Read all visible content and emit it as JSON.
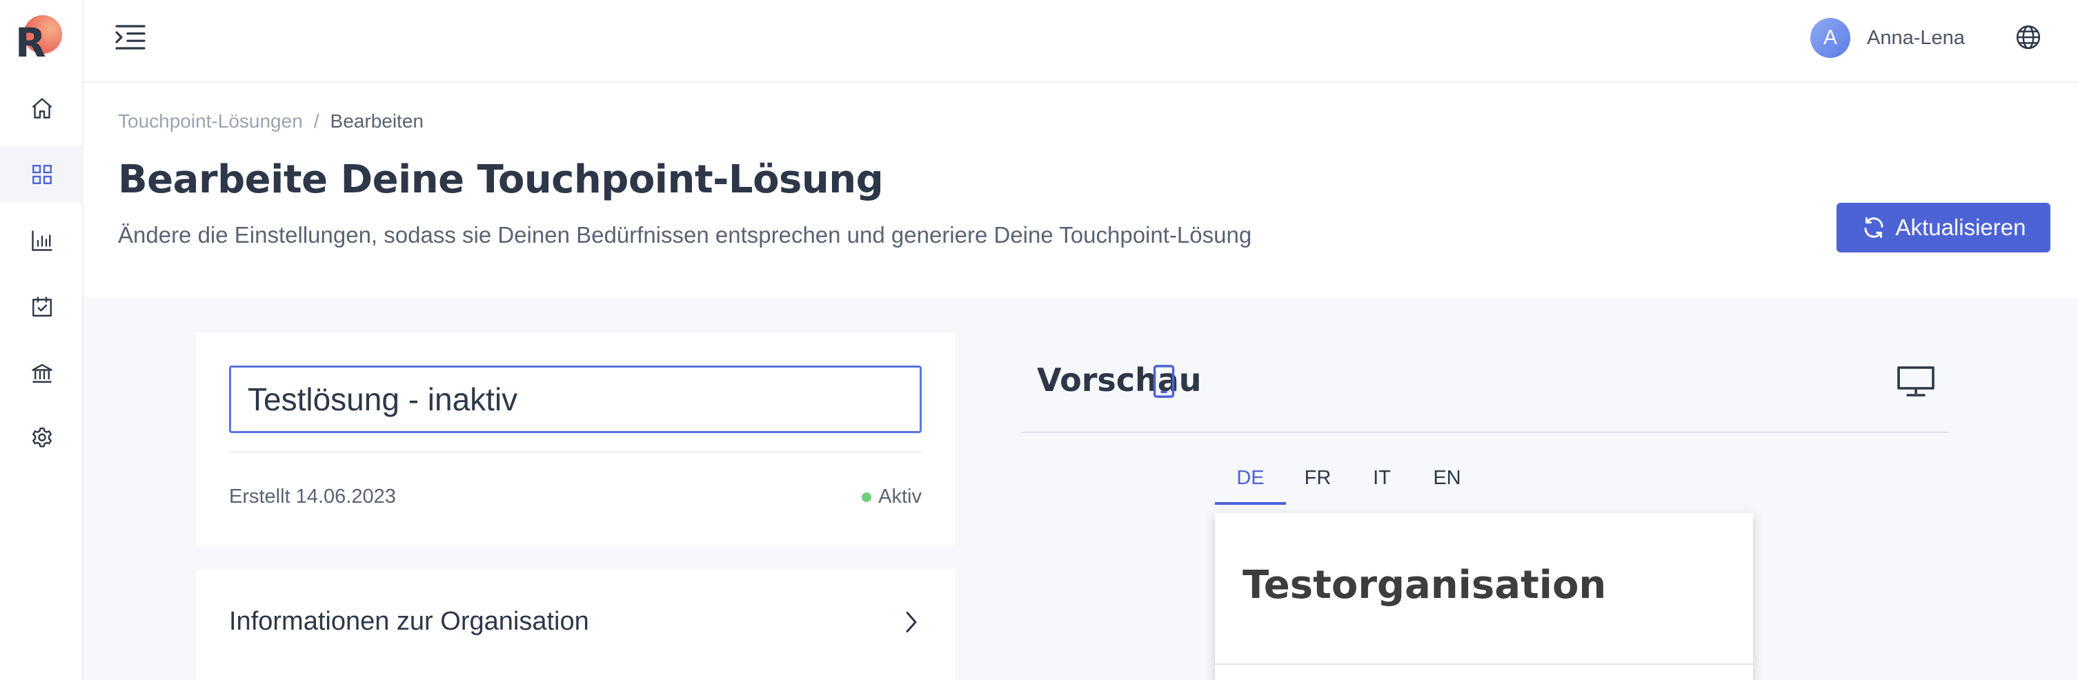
{
  "app": {
    "logo_letter": "R",
    "accent_color": "#4c63d6"
  },
  "sidebar": {
    "items": [
      {
        "name": "home",
        "icon": "home-icon"
      },
      {
        "name": "dashboard",
        "icon": "grid-icon",
        "active": true
      },
      {
        "name": "analytics",
        "icon": "bar-chart-icon"
      },
      {
        "name": "tasks",
        "icon": "calendar-check-icon"
      },
      {
        "name": "institution",
        "icon": "bank-icon"
      },
      {
        "name": "settings",
        "icon": "gear-icon"
      }
    ]
  },
  "topbar": {
    "user": {
      "initial": "A",
      "name": "Anna-Lena"
    }
  },
  "header": {
    "breadcrumb": {
      "parent": "Touchpoint-Lösungen",
      "separator": "/",
      "current": "Bearbeiten"
    },
    "title": "Bearbeite Deine Touchpoint-Lösung",
    "subtitle": "Ändere die Einstellungen, sodass sie Deinen Bedürfnissen entsprechen und generiere Deine Touchpoint-Lösung",
    "refresh_label": "Aktualisieren"
  },
  "solution_card": {
    "name_value": "Testlösung - inaktiv",
    "created": "Erstellt 14.06.2023",
    "status": "Aktiv",
    "status_color": "#6fcf7f"
  },
  "org_card": {
    "label": "Informationen zur Organisation"
  },
  "preview": {
    "title": "Vorschau",
    "languages": [
      "DE",
      "FR",
      "IT",
      "EN"
    ],
    "active_language": "DE",
    "org_name": "Testorganisation"
  }
}
